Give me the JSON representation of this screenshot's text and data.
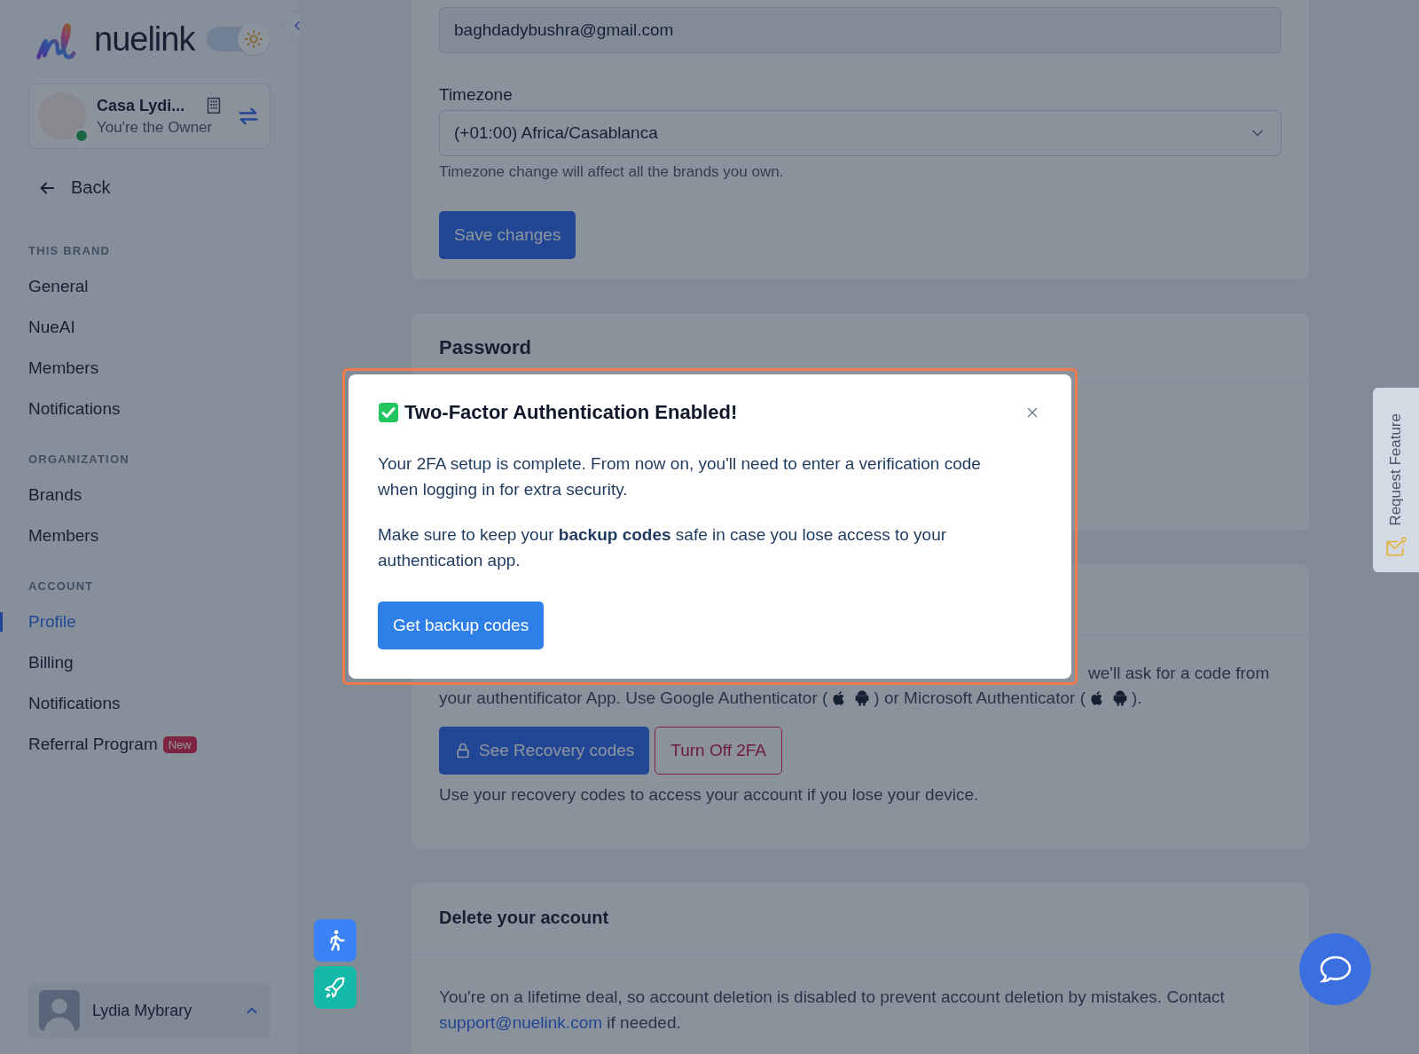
{
  "sidebar": {
    "logo_text": "nuelink",
    "theme_toggle": {
      "on": true
    },
    "brand": {
      "name": "Casa Lydi...",
      "role": "You're the Owner",
      "online": true
    },
    "back": "Back",
    "sections": [
      {
        "title": "THIS BRAND",
        "items": [
          {
            "label": "General",
            "selected": false
          },
          {
            "label": "NueAI",
            "selected": false
          },
          {
            "label": "Members",
            "selected": false
          },
          {
            "label": "Notifications",
            "selected": false
          }
        ]
      },
      {
        "title": "ORGANIZATION",
        "items": [
          {
            "label": "Brands",
            "selected": false
          },
          {
            "label": "Members",
            "selected": false
          }
        ]
      },
      {
        "title": "ACCOUNT",
        "items": [
          {
            "label": "Profile",
            "selected": true
          },
          {
            "label": "Billing",
            "selected": false
          },
          {
            "label": "Notifications",
            "selected": false
          },
          {
            "label": "Referral Program",
            "selected": false,
            "badge": "New"
          }
        ]
      }
    ],
    "user": {
      "name": "Lydia Mybrary"
    }
  },
  "profile": {
    "email": "baghdadybushra@gmail.com",
    "timezone_label": "Timezone",
    "timezone": "(+01:00) Africa/Casablanca",
    "timezone_hint": "Timezone change will affect all the brands you own.",
    "save_button": "Save changes"
  },
  "password": {
    "title": "Password"
  },
  "two_factor": {
    "visible_line": "we'll ask for a code from",
    "segments": [
      "your authentificator App. Use Google Authenticator (",
      ") or Microsoft Authenticator (",
      ")."
    ],
    "recovery_button": "See Recovery codes",
    "turn_off_button": "Turn Off 2FA",
    "hint": "Use your recovery codes to access your account if you lose your device."
  },
  "delete_account": {
    "title": "Delete your account",
    "text": "You're on a lifetime deal, so account deletion is disabled to prevent account deletion by mistakes. Contact",
    "link": "support@nuelink.com",
    "after": "if needed."
  },
  "request_feature": "Request Feature",
  "modal": {
    "title": "Two-Factor Authentication Enabled!",
    "paragraphs": [
      "Your 2FA setup is complete. From now on, you'll need to enter a verification code when logging in for extra security.",
      "Make sure to keep your **backup codes** safe in case you lose access to your authentication app."
    ],
    "button": "Get backup codes"
  }
}
